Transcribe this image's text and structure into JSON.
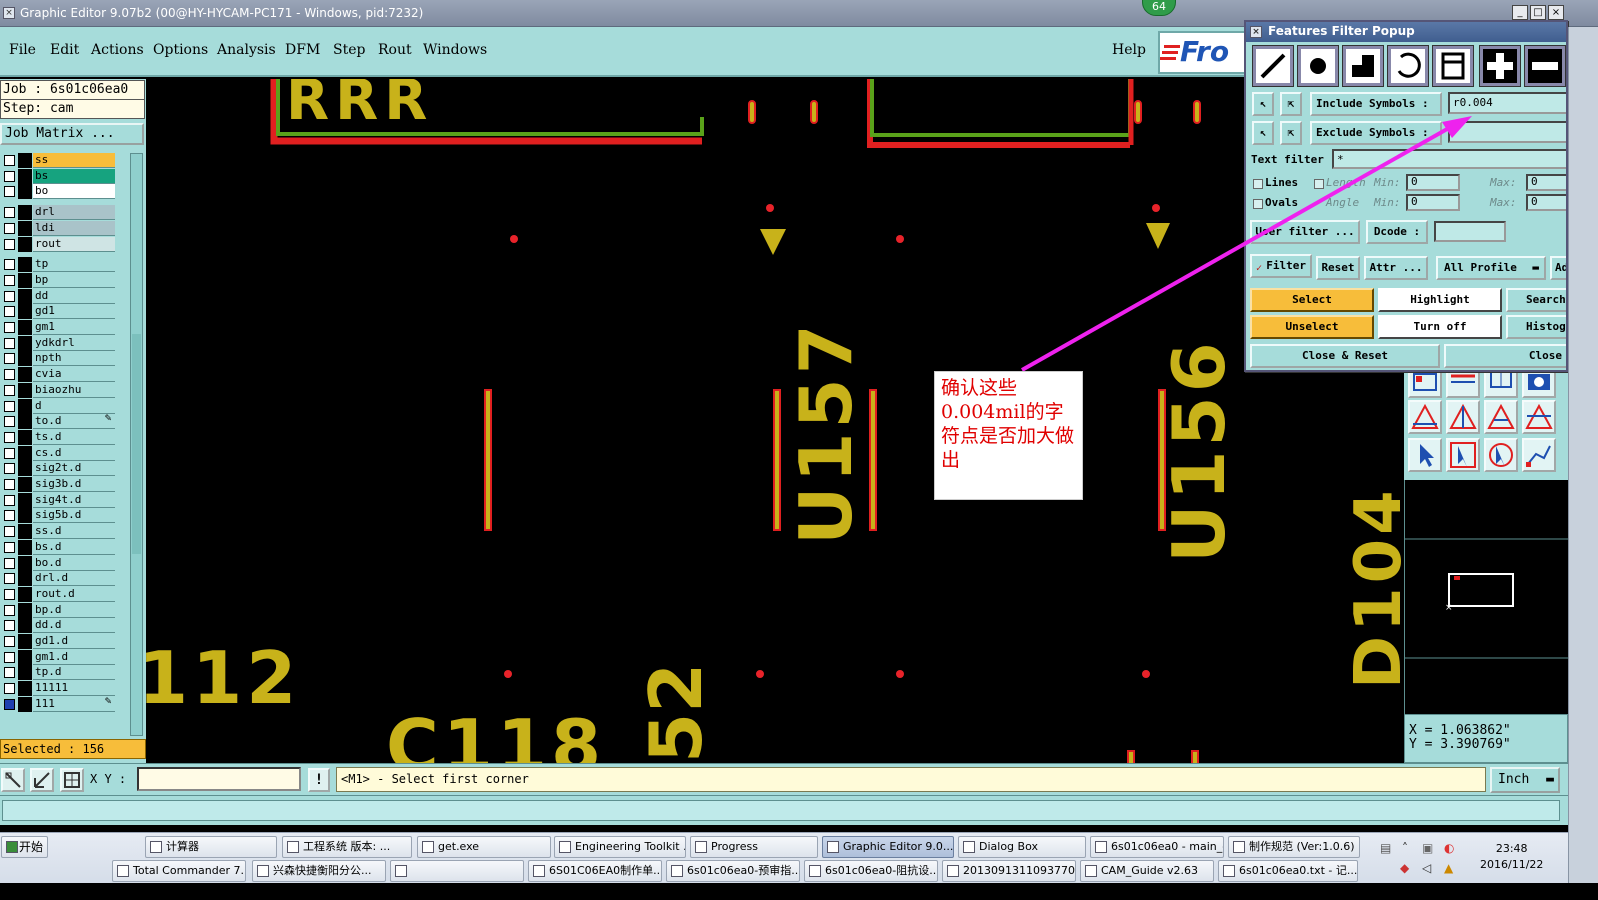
{
  "window": {
    "title": "Graphic Editor 9.07b2 (00@HY-HYCAM-PC171 - Windows, pid:7232)",
    "badge": "64",
    "min": "_",
    "max": "□",
    "close": "×"
  },
  "menu": {
    "items": [
      "File",
      "Edit",
      "Actions",
      "Options",
      "Analysis",
      "DFM",
      "Step",
      "Rout",
      "Windows"
    ],
    "help": "Help",
    "logo_text": "Fro"
  },
  "job": {
    "job_line": "Job : 6s01c06ea0",
    "step_line": "Step: cam",
    "matrix_label": "Job Matrix ..."
  },
  "layers": [
    {
      "name": "ss",
      "color": "#f7bd3a"
    },
    {
      "name": "bs",
      "color": "#16a37f"
    },
    {
      "name": "bo",
      "color": "#ffffff"
    },
    {
      "name": "drl",
      "color": "#a9c3c9"
    },
    {
      "name": "ldi",
      "color": "#a9c3c9"
    },
    {
      "name": "rout",
      "color": "#cfe4e4"
    },
    {
      "name": "tp",
      "color": "#a6dcda"
    },
    {
      "name": "bp",
      "color": "#a6dcda"
    },
    {
      "name": "dd",
      "color": "#a6dcda"
    },
    {
      "name": "gd1",
      "color": "#a6dcda"
    },
    {
      "name": "gm1",
      "color": "#a6dcda"
    },
    {
      "name": "ydkdrl",
      "color": "#a6dcda"
    },
    {
      "name": "npth",
      "color": "#a6dcda"
    },
    {
      "name": "cvia",
      "color": "#a6dcda"
    },
    {
      "name": "biaozhu",
      "color": "#a6dcda"
    },
    {
      "name": "d",
      "color": "#a6dcda"
    },
    {
      "name": "to.d",
      "color": "#a6dcda"
    },
    {
      "name": "ts.d",
      "color": "#a6dcda"
    },
    {
      "name": "cs.d",
      "color": "#a6dcda"
    },
    {
      "name": "sig2t.d",
      "color": "#a6dcda"
    },
    {
      "name": "sig3b.d",
      "color": "#a6dcda"
    },
    {
      "name": "sig4t.d",
      "color": "#a6dcda"
    },
    {
      "name": "sig5b.d",
      "color": "#a6dcda"
    },
    {
      "name": "ss.d",
      "color": "#a6dcda"
    },
    {
      "name": "bs.d",
      "color": "#a6dcda"
    },
    {
      "name": "bo.d",
      "color": "#a6dcda"
    },
    {
      "name": "drl.d",
      "color": "#a6dcda"
    },
    {
      "name": "rout.d",
      "color": "#a6dcda"
    },
    {
      "name": "bp.d",
      "color": "#a6dcda"
    },
    {
      "name": "dd.d",
      "color": "#a6dcda"
    },
    {
      "name": "gd1.d",
      "color": "#a6dcda"
    },
    {
      "name": "gm1.d",
      "color": "#a6dcda"
    },
    {
      "name": "tp.d",
      "color": "#a6dcda"
    },
    {
      "name": "11111",
      "color": "#a6dcda"
    },
    {
      "name": "111",
      "color": "#a6dcda"
    }
  ],
  "selected": "Selected : 156",
  "canvas": {
    "labels": [
      "RRR",
      "U157",
      "U156",
      "D104",
      "112",
      "C118",
      "52"
    ],
    "colors": {
      "silk": "#c8b21a",
      "outline": "#e02020",
      "green": "#5aa21a",
      "pad": "#e8232a"
    }
  },
  "popup": {
    "title": "Features Filter Popup",
    "symbol_buttons": [
      "line-icon",
      "pad-icon",
      "surface-icon",
      "arc-icon",
      "text-icon",
      "plus-icon",
      "minus-icon"
    ],
    "include_label": "Include Symbols :",
    "include_value": "r0.004",
    "exclude_label": "Exclude Symbols :",
    "exclude_value": "",
    "text_filter_label": "Text filter",
    "text_filter_value": "*",
    "lines_label": "Lines",
    "ovals_label": "Ovals",
    "length_label": "Length",
    "angle_label": "Angle",
    "min_label": "Min:",
    "max_label": "Max:",
    "min_value": "0",
    "max_value": "0",
    "user_filter": "User filter ...",
    "dcode_label": "Dcode :",
    "dcode_value": "",
    "filter_label": "Filter",
    "reset": "Reset",
    "attr": "Attr ...",
    "profile": "All Profile",
    "add": "Add",
    "select": "Select",
    "highlight": "Highlight",
    "search": "Search",
    "unselect": "Unselect",
    "turn_off": "Turn off",
    "histogram": "Histogram",
    "close_reset": "Close & Reset",
    "close": "Close"
  },
  "annotation": {
    "text": "确认这些0.004mil的字符点是否加大做出",
    "color": "#e00000",
    "arrow_color": "#ee22ee"
  },
  "cmd": {
    "xy_label": "X Y :",
    "xy_value": "",
    "prompt": "<M1> - Select first corner",
    "units": "Inch"
  },
  "coords": {
    "x": "X = 1.063862\"",
    "y": "Y = 3.390769\""
  },
  "taskbar": {
    "start": "开始",
    "row1": [
      "计算器",
      "工程系统  版本: ...",
      "get.exe",
      "Engineering Toolkit ...",
      "Progress",
      "Graphic Editor 9.0...",
      "Dialog Box",
      "6s01c06ea0 - main_qa",
      "制作规范 (Ver:1.0.6)"
    ],
    "row2": [
      "Total Commander 7....",
      "兴森快捷衡阳分公...",
      "",
      "6S01C06EA0制作单...",
      "6s01c06ea0-预审指...",
      "6s01c06ea0-阻抗设...",
      "2013091311093770...",
      "CAM_Guide v2.63",
      "6s01c06ea0.txt - 记..."
    ],
    "time": "23:48",
    "date": "2016/11/22"
  }
}
